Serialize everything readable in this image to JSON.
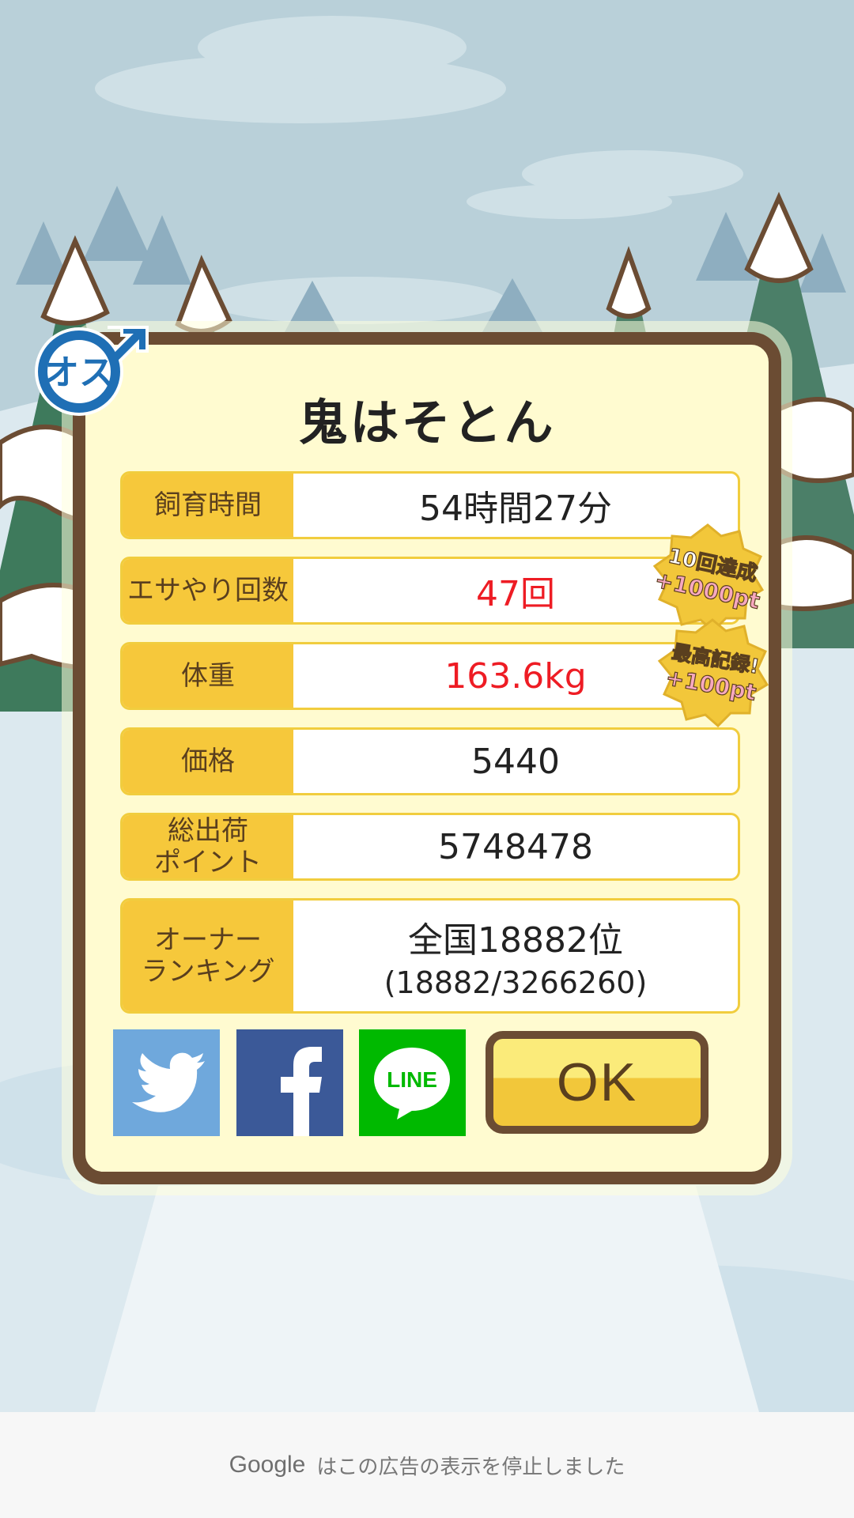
{
  "pet_name": "鬼はそとん",
  "gender_badge": "オス",
  "stats": [
    {
      "label": "飼育時間",
      "value": "54時間27分"
    },
    {
      "label": "エサやり回数",
      "value": "47回"
    },
    {
      "label": "体重",
      "value": "163.6kg"
    },
    {
      "label": "価格",
      "value": "5440"
    },
    {
      "label": "総出荷\nポイント",
      "value": "5748478"
    },
    {
      "label": "オーナー\nランキング",
      "value": "全国18882位",
      "sub_value": "(18882/3266260)"
    }
  ],
  "achievements": [
    {
      "line1": "10回達成",
      "line2": "+1000pt"
    },
    {
      "line1": "最高記録!",
      "line2": "+100pt"
    }
  ],
  "share": {
    "twitter": "twitter-icon",
    "facebook": "facebook-icon",
    "line": "LINE"
  },
  "ok_label": "OK",
  "ad_notice": {
    "brand": "Google",
    "text": "はこの広告の表示を停止しました"
  },
  "colors": {
    "accent": "#f6c83b",
    "frame": "#6b4c33",
    "panel": "#fffbd0",
    "highlight": "#ee1c24"
  }
}
